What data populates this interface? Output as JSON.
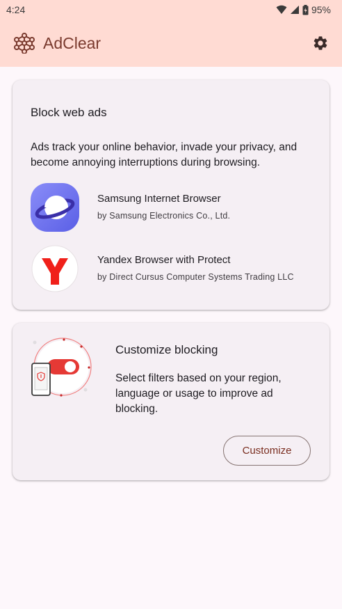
{
  "status_bar": {
    "time": "4:24",
    "battery": "95%"
  },
  "app_bar": {
    "title": "AdClear",
    "settings_icon": "gear-icon",
    "logo_icon": "network-hexagon-icon"
  },
  "card_block": {
    "title": "Block web ads",
    "description": "Ads track your online behavior, invade your privacy, and become annoying interruptions during browsing.",
    "browsers": [
      {
        "name": "Samsung Internet Browser",
        "developer": "by Samsung Electronics Co., Ltd.",
        "icon": "samsung-internet-icon"
      },
      {
        "name": "Yandex Browser with Protect",
        "developer": "by Direct Cursus Computer Systems Trading LLC",
        "icon": "yandex-icon"
      }
    ]
  },
  "card_customize": {
    "title": "Customize blocking",
    "description": "Select filters based on your region, language or usage to improve ad blocking.",
    "button_label": "Customize",
    "illustration": "phone-toggle-illustration"
  },
  "colors": {
    "app_bar_bg": "#ffdbd3",
    "accent": "#7a2e20",
    "card_bg": "#f5eff4",
    "toggle_red": "#e53935"
  }
}
